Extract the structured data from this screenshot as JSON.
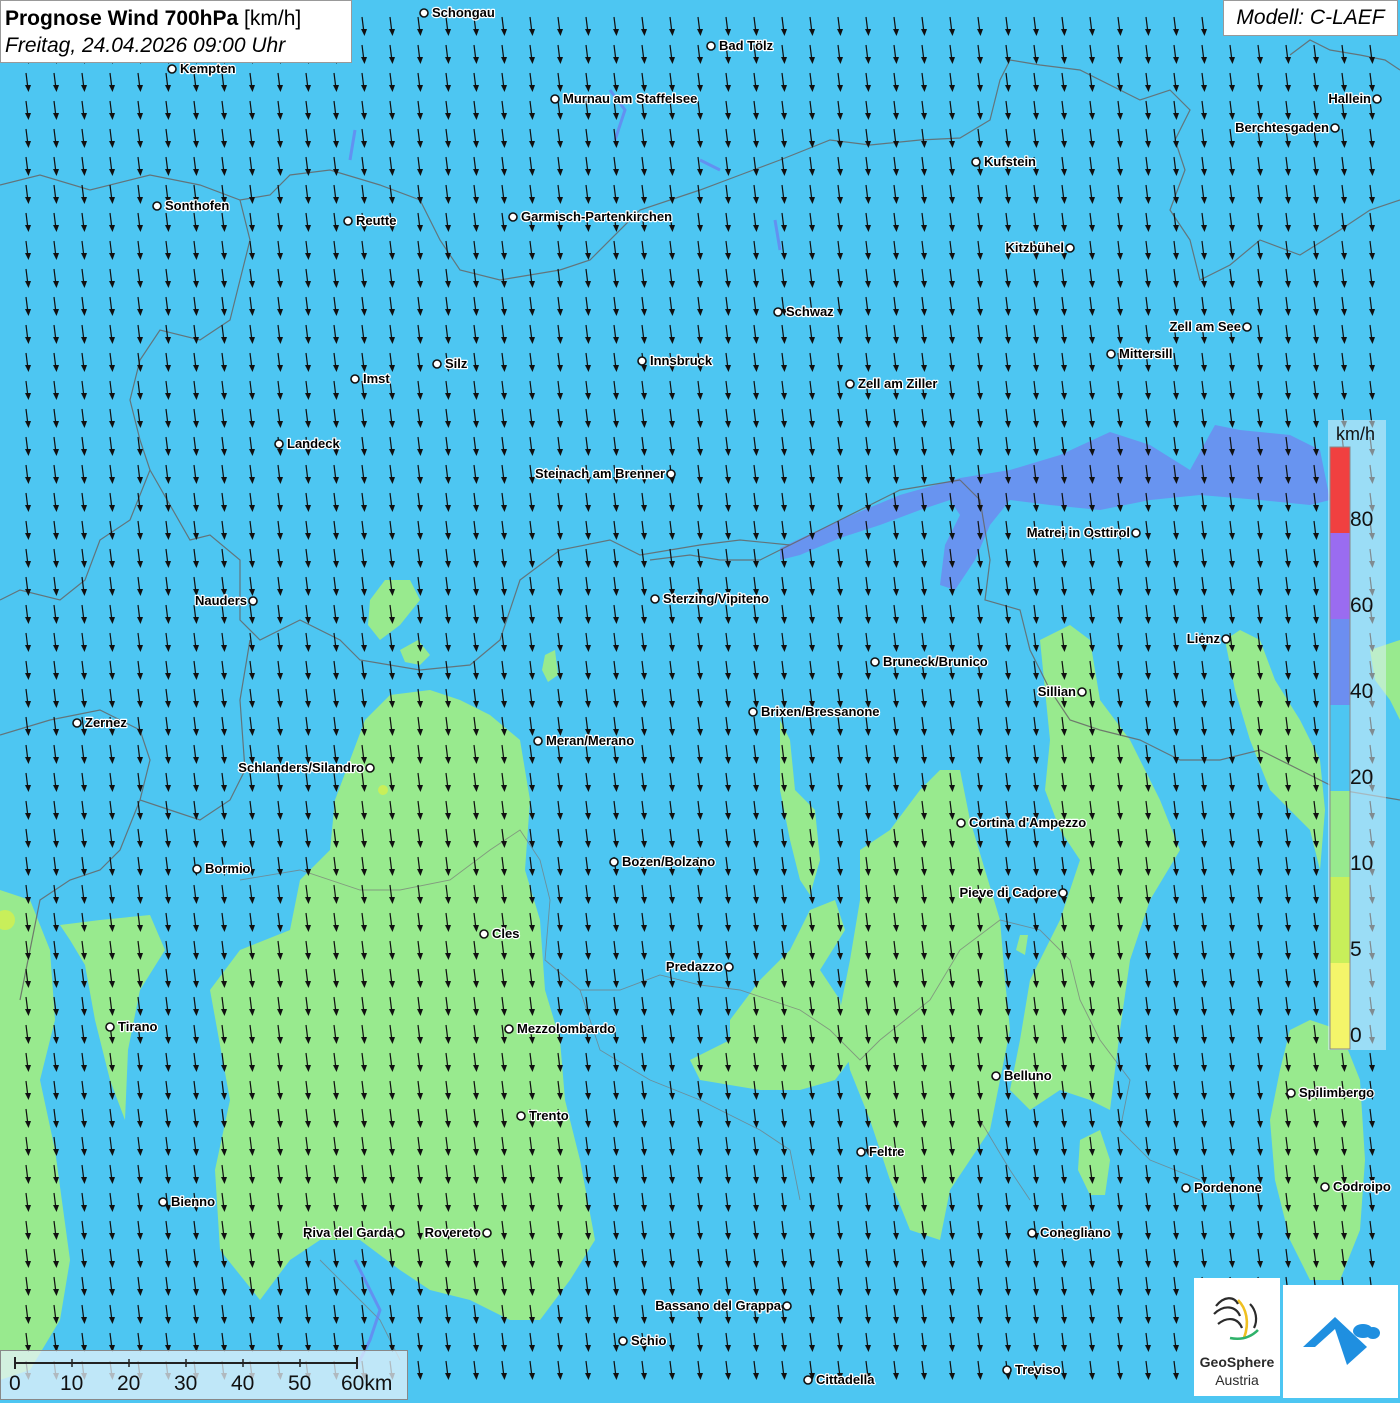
{
  "header": {
    "title_bold": "Prognose Wind 700hPa",
    "title_unit": " [km/h]",
    "datetime": "Freitag, 24.04.2026 09:00 Uhr",
    "model": "Modell: C-LAEF"
  },
  "legend": {
    "unit": "km/h",
    "ticks": [
      "80",
      "60",
      "40",
      "20",
      "10",
      "5",
      "0"
    ],
    "colors": {
      "0-5": "#f4f56a",
      "5-10": "#c8ef5a",
      "10-20": "#98ea8e",
      "20-40": "#4dc6f2",
      "40-60": "#6c8ef0",
      "60-80": "#9a6cf0",
      "80+": "#f04040"
    }
  },
  "scale_bar": {
    "labels": [
      "0",
      "10",
      "20",
      "30",
      "40",
      "50",
      "60km"
    ]
  },
  "cities": [
    {
      "name": "Schongau",
      "label_side": "right"
    },
    {
      "name": "Bad Tölz",
      "label_side": "right"
    },
    {
      "name": "Kempten",
      "label_side": "right"
    },
    {
      "name": "Murnau am Staffelsee",
      "label_side": "right"
    },
    {
      "name": "Hallein",
      "label_side": "left"
    },
    {
      "name": "Berchtesgaden",
      "label_side": "left"
    },
    {
      "name": "Kufstein",
      "label_side": "right"
    },
    {
      "name": "Sonthofen",
      "label_side": "right"
    },
    {
      "name": "Reutte",
      "label_side": "right"
    },
    {
      "name": "Garmisch-Partenkirchen",
      "label_side": "right"
    },
    {
      "name": "Kitzbühel",
      "label_side": "left"
    },
    {
      "name": "Schwaz",
      "label_side": "right"
    },
    {
      "name": "Zell am See",
      "label_side": "left"
    },
    {
      "name": "Mittersill",
      "label_side": "right"
    },
    {
      "name": "Innsbruck",
      "label_side": "right"
    },
    {
      "name": "Silz",
      "label_side": "right"
    },
    {
      "name": "Imst",
      "label_side": "right"
    },
    {
      "name": "Zell am Ziller",
      "label_side": "right"
    },
    {
      "name": "Landeck",
      "label_side": "right"
    },
    {
      "name": "Steinach am Brenner",
      "label_side": "left"
    },
    {
      "name": "Matrei in Osttirol",
      "label_side": "left"
    },
    {
      "name": "Nauders",
      "label_side": "left"
    },
    {
      "name": "Sterzing/Vipiteno",
      "label_side": "right"
    },
    {
      "name": "Lienz",
      "label_side": "left"
    },
    {
      "name": "Bruneck/Brunico",
      "label_side": "right"
    },
    {
      "name": "Sillian",
      "label_side": "left"
    },
    {
      "name": "Zernez",
      "label_side": "right"
    },
    {
      "name": "Brixen/Bressanone",
      "label_side": "right"
    },
    {
      "name": "Meran/Merano",
      "label_side": "right"
    },
    {
      "name": "Schlanders/Silandro",
      "label_side": "left"
    },
    {
      "name": "Cortina d'Ampezzo",
      "label_side": "right"
    },
    {
      "name": "Bozen/Bolzano",
      "label_side": "right"
    },
    {
      "name": "Pieve di Cadore",
      "label_side": "left"
    },
    {
      "name": "Bormio",
      "label_side": "right"
    },
    {
      "name": "Cles",
      "label_side": "right"
    },
    {
      "name": "Predazzo",
      "label_side": "left"
    },
    {
      "name": "Tirano",
      "label_side": "right"
    },
    {
      "name": "Mezzolombardo",
      "label_side": "right"
    },
    {
      "name": "Belluno",
      "label_side": "right"
    },
    {
      "name": "Spilimbergo",
      "label_side": "right"
    },
    {
      "name": "Trento",
      "label_side": "right"
    },
    {
      "name": "Feltre",
      "label_side": "right"
    },
    {
      "name": "Pordenone",
      "label_side": "right"
    },
    {
      "name": "Codroipo",
      "label_side": "right"
    },
    {
      "name": "Bienno",
      "label_side": "right"
    },
    {
      "name": "Riva del Garda",
      "label_side": "left"
    },
    {
      "name": "Rovereto",
      "label_side": "left"
    },
    {
      "name": "Conegliano",
      "label_side": "right"
    },
    {
      "name": "Bassano del Grappa",
      "label_side": "left"
    },
    {
      "name": "Schio",
      "label_side": "right"
    },
    {
      "name": "Cittadella",
      "label_side": "right"
    },
    {
      "name": "Treviso",
      "label_side": "right"
    }
  ],
  "logos": {
    "geosphere_name": "GeoSphere",
    "geosphere_sub": "Austria"
  }
}
